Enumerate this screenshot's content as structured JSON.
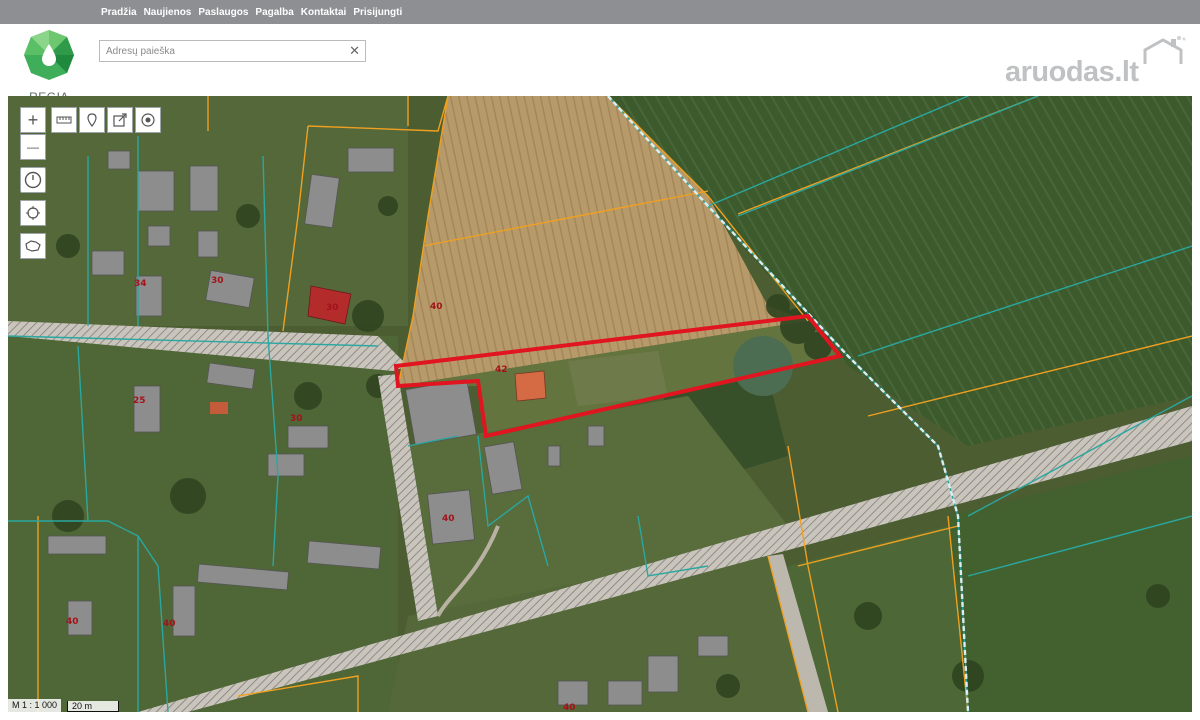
{
  "nav": {
    "items": [
      "Pradžia",
      "Naujienos",
      "Paslaugos",
      "Pagalba",
      "Kontaktai",
      "Prisijungti"
    ]
  },
  "logo": {
    "text": "REGIA"
  },
  "search": {
    "placeholder": "Adresų paieška",
    "clear": "✕"
  },
  "brand": {
    "text": "aruodas.lt"
  },
  "map": {
    "parcel_labels": [
      "34",
      "30",
      "30",
      "40",
      "42",
      "25",
      "30",
      "40",
      "40",
      "40",
      "40"
    ],
    "highlight_color": "#e0151f",
    "boundary_colors": {
      "orange": "#f0a020",
      "teal": "#2aa7a0"
    },
    "scale_ratio": "M 1 : 1 000",
    "scale_bar": "20 m"
  },
  "controls": {
    "zoom_in": "+",
    "zoom_out": "—",
    "icons": [
      "measure-icon",
      "marker-icon",
      "export-icon",
      "layers-icon",
      "history-icon",
      "locate-icon",
      "area-icon"
    ]
  }
}
